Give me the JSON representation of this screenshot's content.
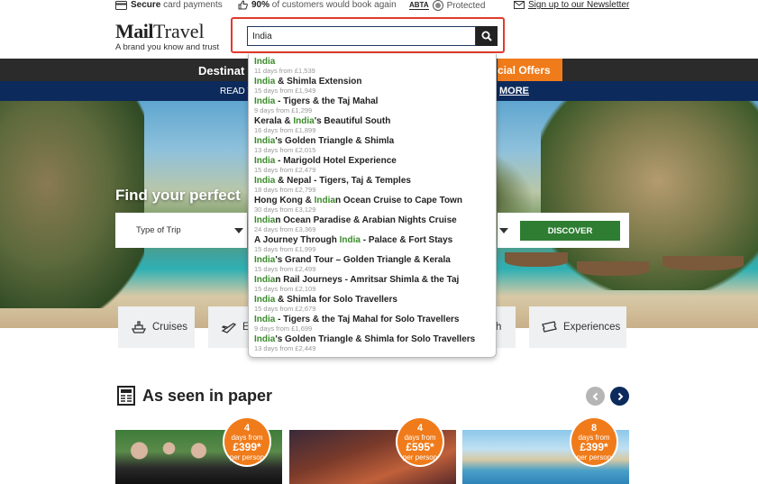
{
  "topbar": {
    "secure_bold": "Secure",
    "secure_rest": " card payments",
    "book_bold": "90%",
    "book_rest": " of customers would book again",
    "abta_label": "ABTA",
    "protected": "Protected",
    "newsletter": "Sign up to our Newsletter"
  },
  "logo": {
    "brand_bold": "Mail",
    "brand_rest": "Travel",
    "tagline": "A brand you know and trust"
  },
  "search": {
    "value": "India",
    "icon": "search-icon"
  },
  "nav": {
    "destinations": "Destinat",
    "special_offers": "cial Offers",
    "read": "READ T",
    "more": "MORE"
  },
  "hero": {
    "title": "Find your perfect",
    "trip_type_label": "Type of Trip",
    "discover_label": "DISCOVER"
  },
  "tiles": [
    {
      "label": "Cruises",
      "icon": "ship-icon"
    },
    {
      "label": "Es",
      "icon": "plane-icon"
    },
    {
      "label": "h",
      "icon": ""
    },
    {
      "label": "Experiences",
      "icon": "ticket-icon"
    }
  ],
  "paper": {
    "heading": "As seen in paper",
    "icon": "newspaper-icon"
  },
  "carousel": {
    "prev_icon": "chevron-left-icon",
    "next_icon": "chevron-right-icon",
    "prev_color": "#b5b5b5",
    "next_color": "#0d2a5c"
  },
  "cards": [
    {
      "days": "4",
      "days_from": "days from",
      "price": "£399*",
      "per": "per person"
    },
    {
      "days": "4",
      "days_from": "days from",
      "price": "£595*",
      "per": "per person"
    },
    {
      "days": "8",
      "days_from": "days from",
      "price": "£399*",
      "per": "per person"
    }
  ],
  "suggestions": [
    {
      "pre": "",
      "hl": "India",
      "post": "",
      "meta": "11 days from £1,539"
    },
    {
      "pre": "",
      "hl": "India",
      "post": " & Shimla Extension",
      "meta": "15 days from £1,949"
    },
    {
      "pre": "",
      "hl": "India",
      "post": " - Tigers & the Taj Mahal",
      "meta": "9 days from £1,299"
    },
    {
      "pre": "Kerala & ",
      "hl": "India",
      "post": "'s Beautiful South",
      "meta": "16 days from £1,899"
    },
    {
      "pre": "",
      "hl": "India",
      "post": "'s Golden Triangle & Shimla",
      "meta": "13 days from £2,015"
    },
    {
      "pre": "",
      "hl": "India",
      "post": " - Marigold Hotel Experience",
      "meta": "15 days from £2,479"
    },
    {
      "pre": "",
      "hl": "India",
      "post": " & Nepal - Tigers, Taj & Temples",
      "meta": "18 days from £2,799"
    },
    {
      "pre": "Hong Kong & ",
      "hl": "India",
      "post": "n Ocean Cruise to Cape Town",
      "meta": "30 days from £3,129"
    },
    {
      "pre": "",
      "hl": "India",
      "post": "n Ocean Paradise & Arabian Nights Cruise",
      "meta": "24 days from £3,369"
    },
    {
      "pre": "A Journey Through ",
      "hl": "India",
      "post": " - Palace & Fort Stays",
      "meta": "15 days from £1,999"
    },
    {
      "pre": "",
      "hl": "India",
      "post": "'s Grand Tour – Golden Triangle & Kerala",
      "meta": "15 days from £2,499"
    },
    {
      "pre": "",
      "hl": "India",
      "post": "n Rail Journeys - Amritsar Shimla & the Taj",
      "meta": "15 days from £2,109"
    },
    {
      "pre": "",
      "hl": "India",
      "post": " & Shimla for Solo Travellers",
      "meta": "15 days from £2,679"
    },
    {
      "pre": "",
      "hl": "India",
      "post": " - Tigers & the Taj Mahal for Solo Travellers",
      "meta": "9 days from £1,699"
    },
    {
      "pre": "",
      "hl": "India",
      "post": "'s Golden Triangle & Shimla for Solo Travellers",
      "meta": "13 days from £2,449"
    }
  ]
}
